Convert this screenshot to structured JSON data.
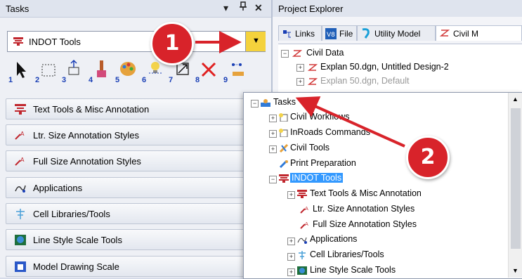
{
  "tasks_panel": {
    "title": "Tasks",
    "controls": [
      "▾",
      "⁴",
      "✕"
    ],
    "combo_value": "INDOT Tools",
    "tool_numbers": [
      "1",
      "2",
      "3",
      "4",
      "5",
      "6",
      "7",
      "8",
      "9"
    ],
    "rows": [
      {
        "label": "Text Tools & Misc Annotation",
        "icon": "indot-tools-icon"
      },
      {
        "label": "Ltr. Size Annotation Styles",
        "icon": "annotation-style-icon"
      },
      {
        "label": "Full Size Annotation Styles",
        "icon": "annotation-style-icon"
      },
      {
        "label": "Applications",
        "icon": "applications-icon"
      },
      {
        "label": "Cell Libraries/Tools",
        "icon": "cell-library-icon"
      },
      {
        "label": "Line Style Scale Tools",
        "icon": "line-style-icon"
      },
      {
        "label": "Model Drawing Scale",
        "icon": "drawing-scale-icon"
      }
    ]
  },
  "project_explorer": {
    "title": "Project Explorer",
    "tabs": [
      "Links",
      "File",
      "Utility Model",
      "Civil M"
    ],
    "tree": [
      "Civil Data",
      "Explan 50.dgn, Untitled Design-2",
      "Explan 50.dgn, Default"
    ]
  },
  "popup_tree": {
    "items": [
      {
        "label": "Tasks",
        "level": 0
      },
      {
        "label": "Civil Workflows",
        "level": 1
      },
      {
        "label": "InRoads Commands",
        "level": 1
      },
      {
        "label": "Civil Tools",
        "level": 1
      },
      {
        "label": "Print Preparation",
        "level": 1
      },
      {
        "label": "INDOT Tools",
        "level": 1
      },
      {
        "label": "Text Tools & Misc Annotation",
        "level": 2
      },
      {
        "label": "Ltr. Size Annotation Styles",
        "level": 2
      },
      {
        "label": "Full Size Annotation Styles",
        "level": 2
      },
      {
        "label": "Applications",
        "level": 2
      },
      {
        "label": "Cell Libraries/Tools",
        "level": 2
      },
      {
        "label": "Line Style Scale Tools",
        "level": 2
      }
    ]
  },
  "callouts": [
    "1",
    "2"
  ],
  "colors": {
    "callout_red": "#d8232a",
    "combo_arrow": "#f4d23c",
    "selection": "#3399ff"
  }
}
